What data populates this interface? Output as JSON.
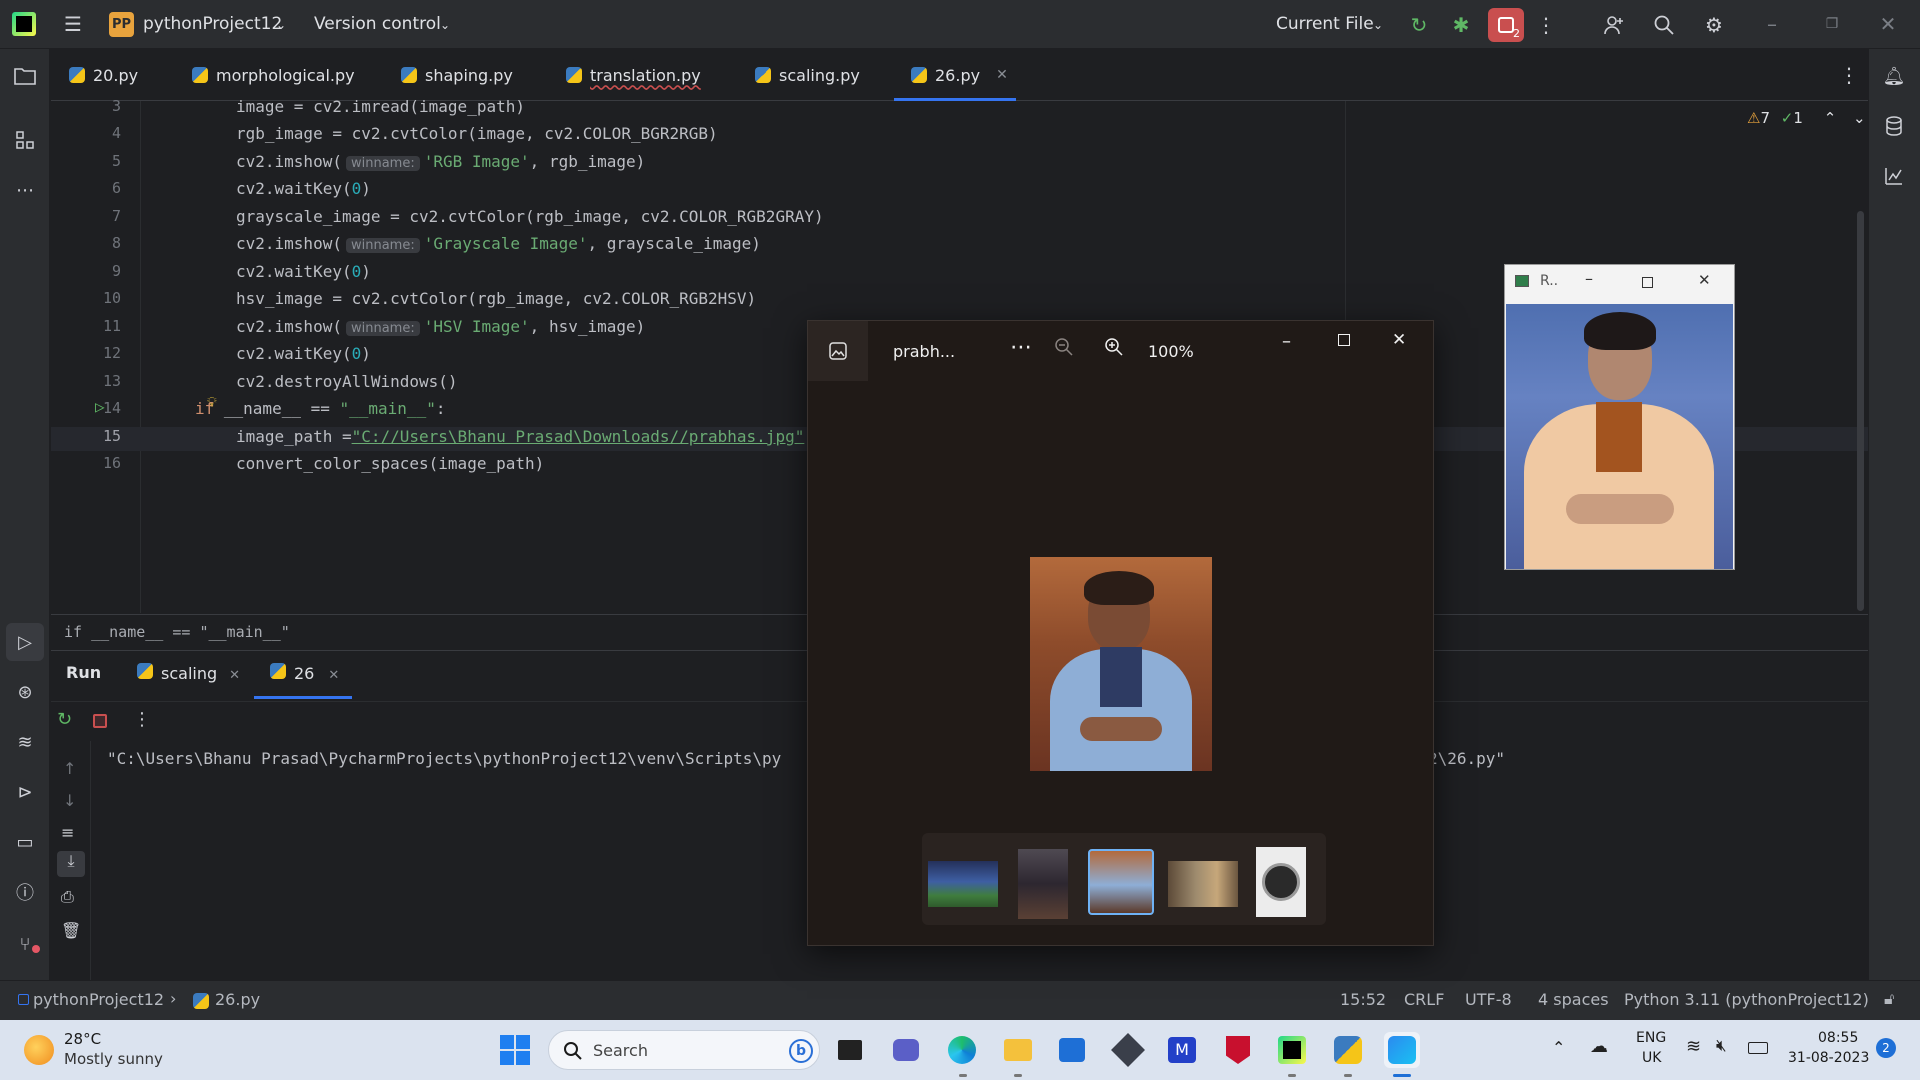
{
  "titlebar": {
    "project_badge": "PP",
    "project_name": "pythonProject12",
    "version_control": "Version control",
    "run_config": "Current File",
    "notif_count": "2"
  },
  "tabs": [
    {
      "label": "20.py"
    },
    {
      "label": "morphological.py"
    },
    {
      "label": "shaping.py"
    },
    {
      "label": "translation.py"
    },
    {
      "label": "scaling.py"
    },
    {
      "label": "26.py"
    }
  ],
  "inspections": {
    "warnings": "7",
    "ok": "1"
  },
  "code_lines": [
    {
      "num": "3",
      "text": "image = cv2.imread(image_path)"
    },
    {
      "num": "4",
      "text": "rgb_image = cv2.cvtColor(image, cv2.COLOR_BGR2RGB)"
    },
    {
      "num": "5",
      "pre": "cv2.imshow(",
      "hint": "winname:",
      "str": "'RGB Image'",
      "post": ", rgb_image)"
    },
    {
      "num": "6",
      "pre": "cv2.waitKey(",
      "n": "0",
      "post": ")"
    },
    {
      "num": "7",
      "text": "grayscale_image = cv2.cvtColor(rgb_image, cv2.COLOR_RGB2GRAY)"
    },
    {
      "num": "8",
      "pre": "cv2.imshow(",
      "hint": "winname:",
      "str": "'Grayscale Image'",
      "post": ", grayscale_image)"
    },
    {
      "num": "9",
      "pre": "cv2.waitKey(",
      "n": "0",
      "post": ")"
    },
    {
      "num": "10",
      "text": "hsv_image = cv2.cvtColor(rgb_image, cv2.COLOR_RGB2HSV)"
    },
    {
      "num": "11",
      "pre": "cv2.imshow(",
      "hint": "winname:",
      "str": "'HSV Image'",
      "post": ", hsv_image)"
    },
    {
      "num": "12",
      "pre": "cv2.waitKey(",
      "n": "0",
      "post": ")"
    },
    {
      "num": "13",
      "text": "cv2.destroyAllWindows()"
    },
    {
      "num": "14",
      "kw": "if",
      "rest": " __name__ == ",
      "str": "\"__main__\"",
      "post": ":"
    },
    {
      "num": "15",
      "pre": "image_path =",
      "str": "\"C://Users\\Bhanu Prasad\\Downloads//prabhas.jpg\""
    },
    {
      "num": "16",
      "text": "convert_color_spaces(image_path)"
    }
  ],
  "breadcrumb": "if __name__ == \"__main__\"",
  "run": {
    "title": "Run",
    "tabs": [
      {
        "label": "scaling"
      },
      {
        "label": "26"
      }
    ],
    "output_left": "\"C:\\Users\\Bhanu Prasad\\PycharmProjects\\pythonProject12\\venv\\Scripts\\py",
    "output_right": "2\\26.py\""
  },
  "photos": {
    "filename": "prabh...",
    "zoom": "100%"
  },
  "cvwin": {
    "title": "R.."
  },
  "status": {
    "project": "pythonProject12",
    "file": "26.py",
    "position": "15:52",
    "line_sep": "CRLF",
    "encoding": "UTF-8",
    "indent": "4 spaces",
    "interpreter": "Python 3.11 (pythonProject12)"
  },
  "taskbar": {
    "temp": "28°C",
    "weather": "Mostly sunny",
    "search_placeholder": "Search",
    "lang1": "ENG",
    "lang2": "UK",
    "time": "08:55",
    "date": "31-08-2023",
    "notif": "2"
  },
  "colors": {
    "accent": "#3574f0",
    "stop": "#c94f4f",
    "string": "#6aab73",
    "keyword": "#cf8e6d"
  }
}
